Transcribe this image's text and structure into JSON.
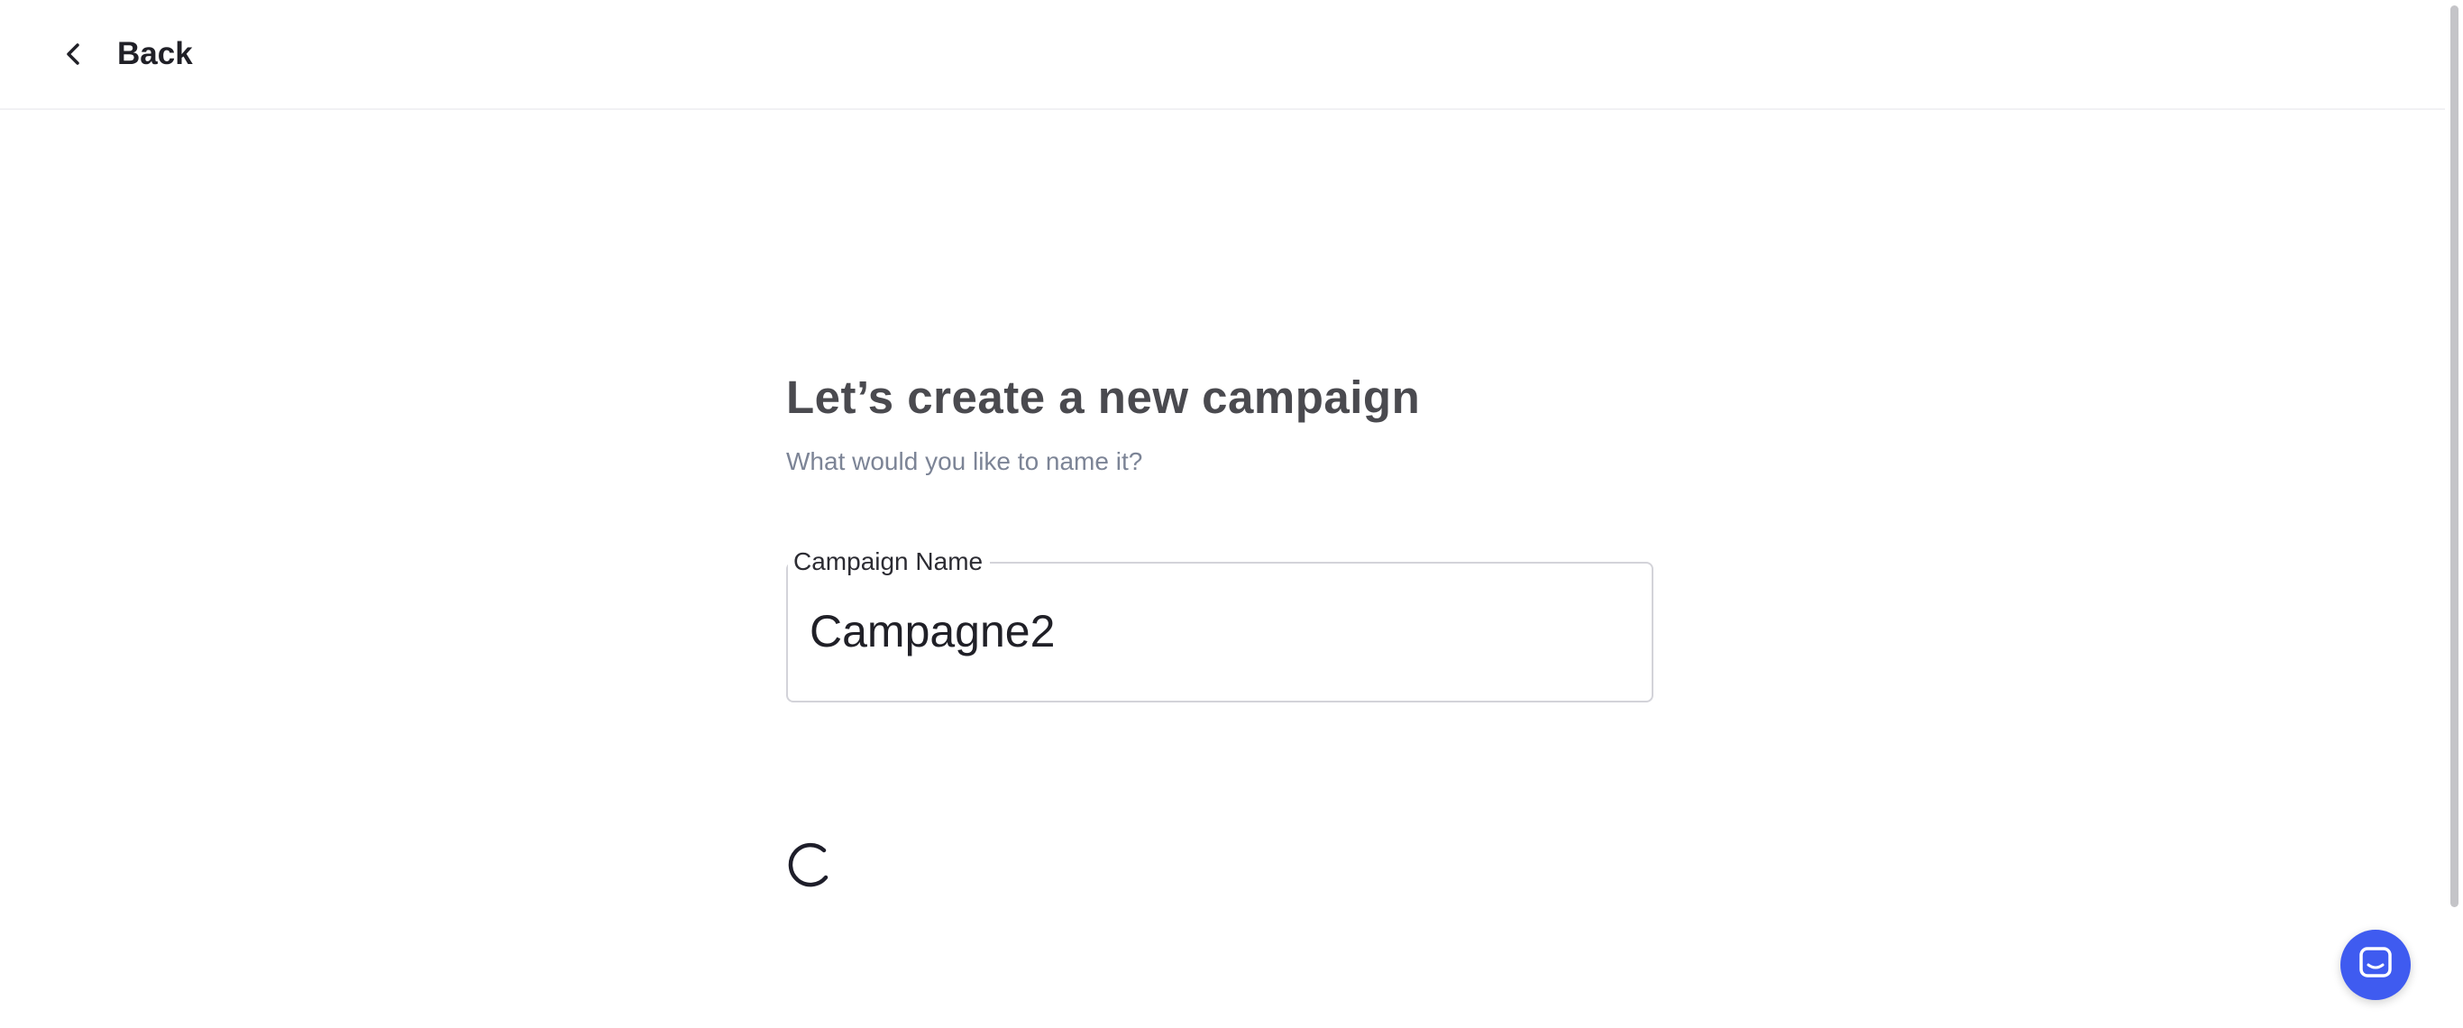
{
  "header": {
    "back_label": "Back"
  },
  "main": {
    "title": "Let’s create a new campaign",
    "subtitle": "What would you like to name it?",
    "campaign_name_field": {
      "label": "Campaign Name",
      "value": "Campagne2"
    }
  },
  "icons": {
    "back": "chevron-left-icon",
    "loading": "spinner-icon",
    "chat": "chat-icon"
  },
  "colors": {
    "accent": "#3f5bf0",
    "title": "#4a4a4f",
    "subtitle": "#7c8496"
  }
}
